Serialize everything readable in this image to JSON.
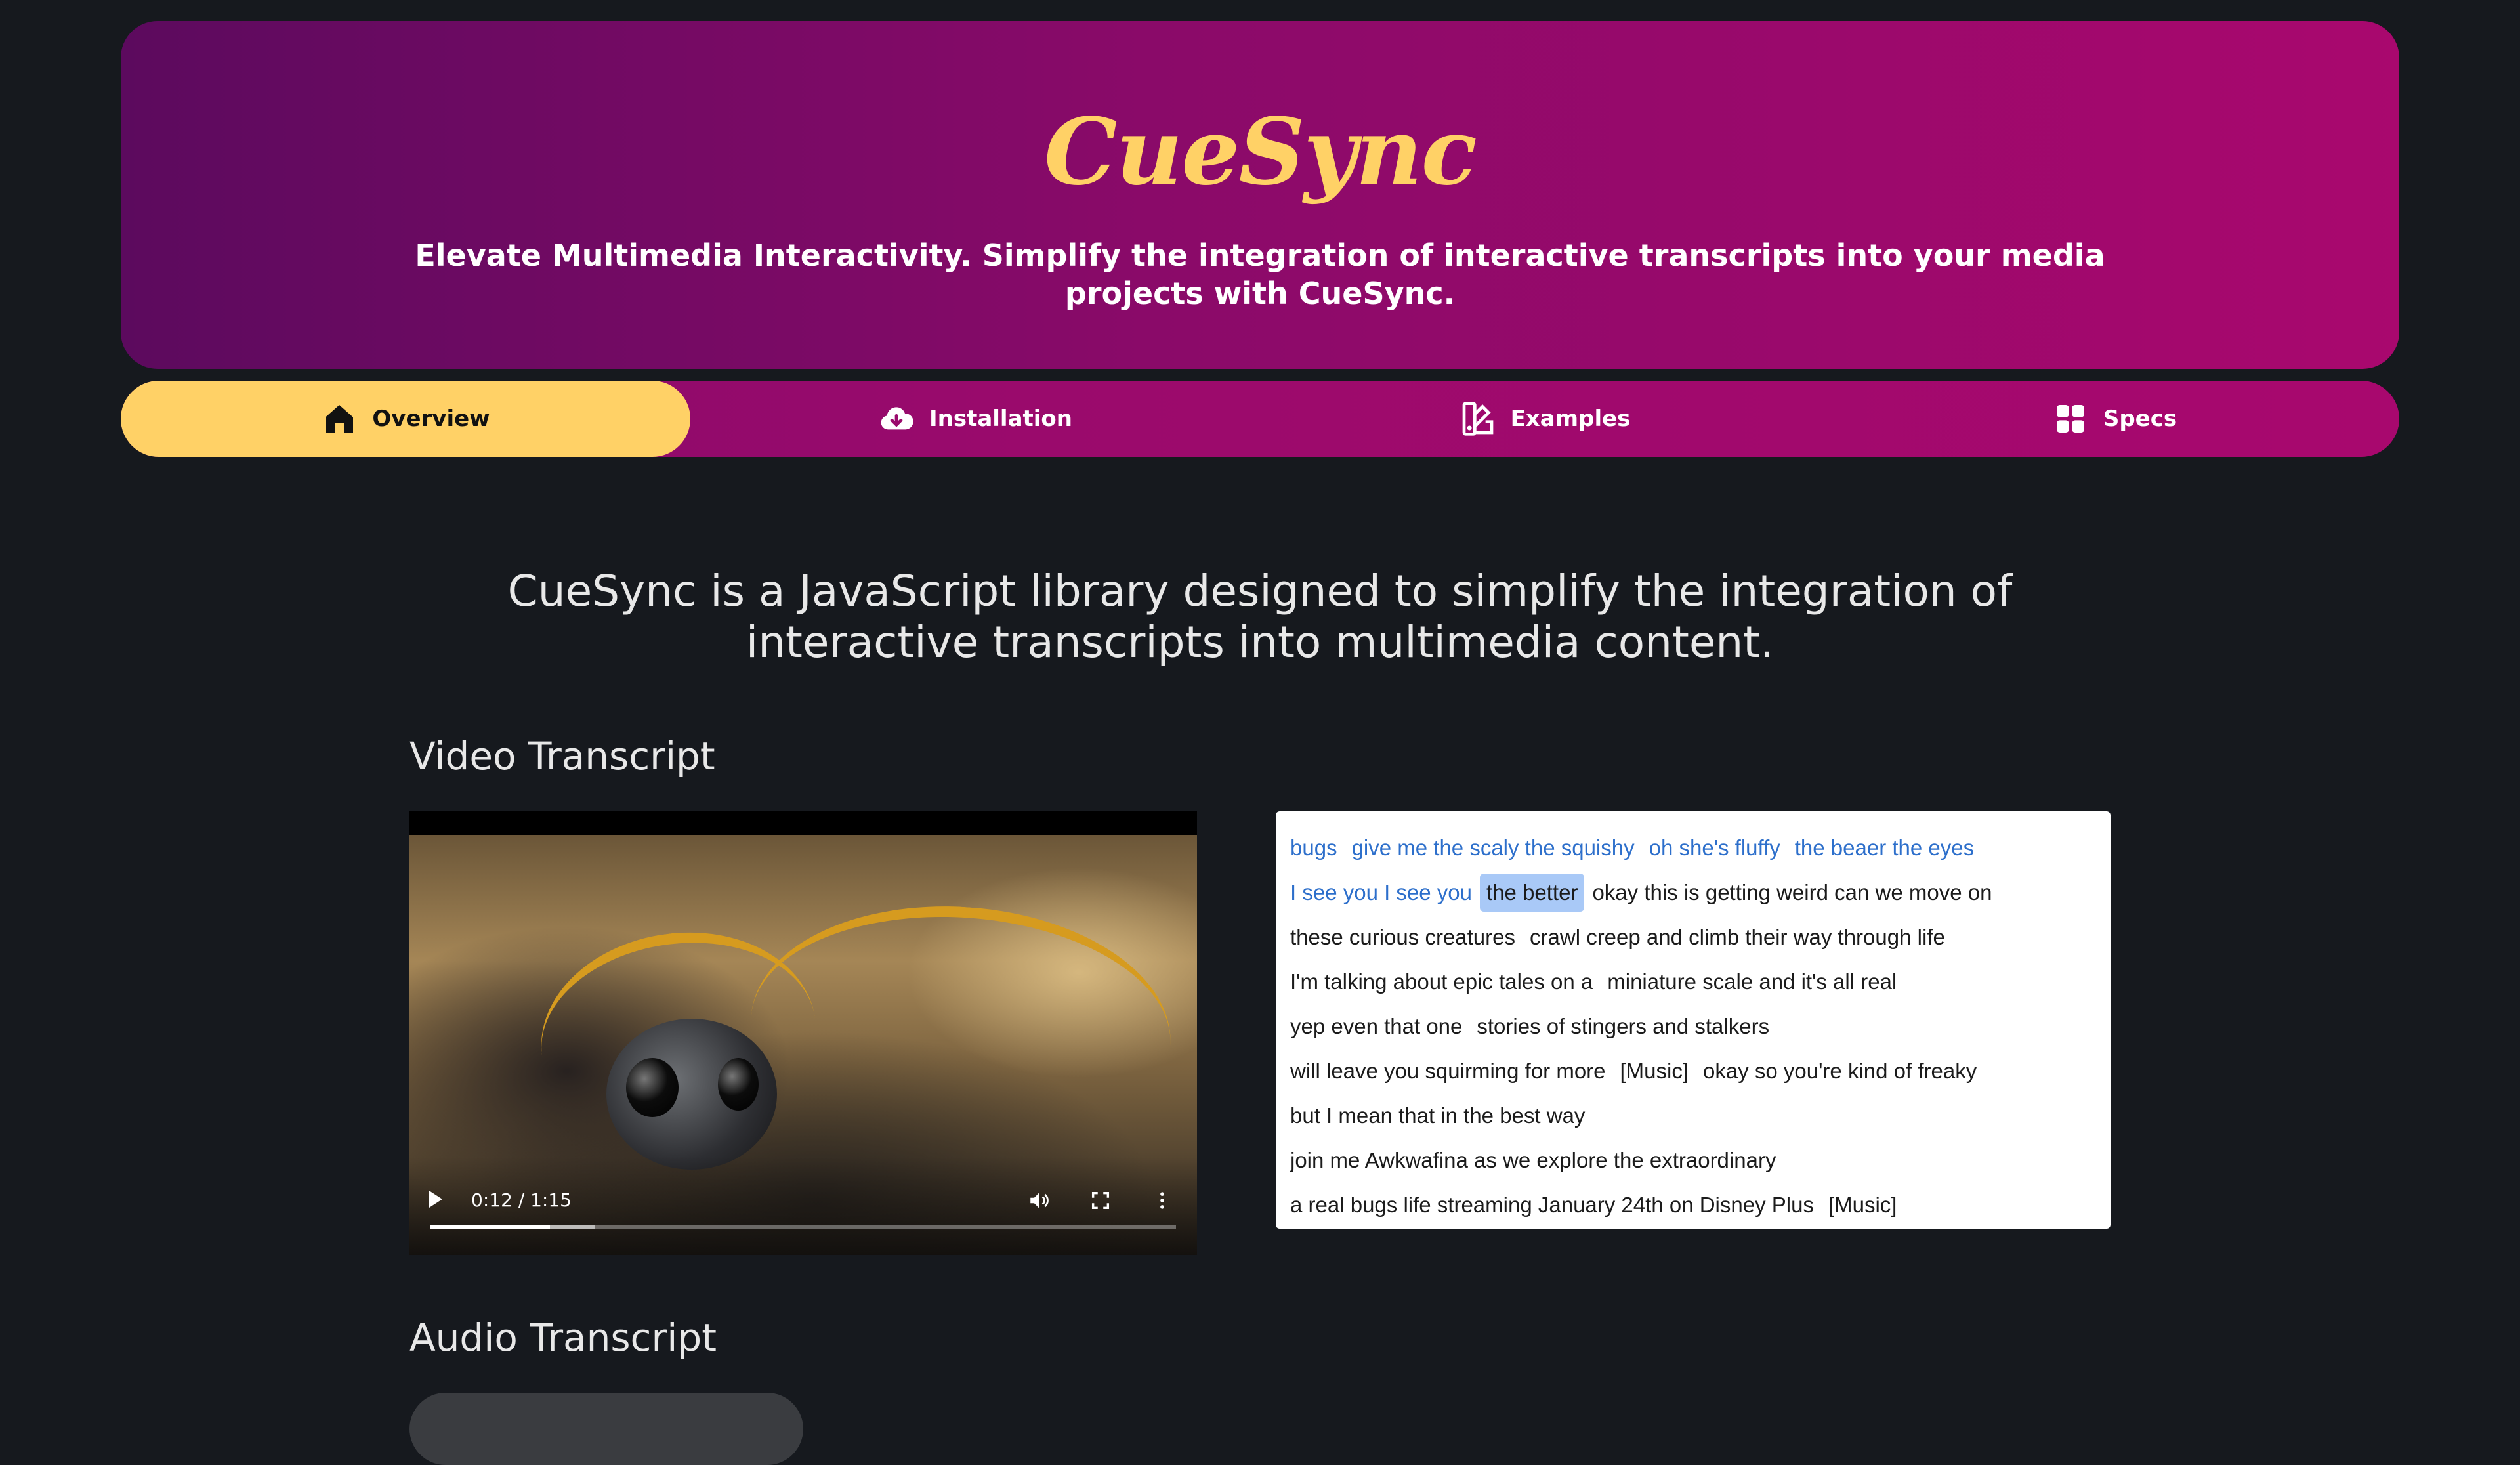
{
  "header": {
    "logo": "CueSync",
    "tagline": "Elevate Multimedia Interactivity. Simplify the integration of interactive transcripts into your media projects with CueSync."
  },
  "nav": {
    "items": [
      {
        "label": "Overview",
        "icon": "home-icon",
        "active": true
      },
      {
        "label": "Installation",
        "icon": "cloud-download-icon",
        "active": false
      },
      {
        "label": "Examples",
        "icon": "swatch-icon",
        "active": false
      },
      {
        "label": "Specs",
        "icon": "grid-icon",
        "active": false
      }
    ]
  },
  "intro": "CueSync is a JavaScript library designed to simplify the integration of interactive transcripts into multimedia content.",
  "sections": {
    "video_title": "Video Transcript",
    "audio_title": "Audio Transcript"
  },
  "video": {
    "time": "0:12 / 1:15",
    "progress_fraction": 0.16,
    "buffered_fraction": 0.22
  },
  "transcript": {
    "lines": [
      [
        {
          "text": "bugs",
          "state": "past"
        },
        {
          "text": "give me the scaly the squishy",
          "state": "past"
        },
        {
          "text": "oh she's fluffy",
          "state": "past"
        },
        {
          "text": "the beaer the eyes",
          "state": "past"
        }
      ],
      [
        {
          "text": "I see you I see you",
          "state": "past"
        },
        {
          "text": "the better",
          "state": "active"
        },
        {
          "text": "okay this is getting weird can we move on",
          "state": "future"
        }
      ],
      [
        {
          "text": "these curious creatures",
          "state": "future"
        },
        {
          "text": "crawl creep and climb their way through life",
          "state": "future"
        }
      ],
      [
        {
          "text": "I'm talking about epic tales on a",
          "state": "future"
        },
        {
          "text": "miniature scale and it's all real",
          "state": "future"
        }
      ],
      [
        {
          "text": "yep even that one",
          "state": "future"
        },
        {
          "text": "stories of stingers and stalkers",
          "state": "future"
        }
      ],
      [
        {
          "text": "will leave you squirming for more",
          "state": "future"
        },
        {
          "text": "[Music]",
          "state": "future"
        },
        {
          "text": "okay so you're kind of freaky",
          "state": "future"
        }
      ],
      [
        {
          "text": "but I mean that in the best way",
          "state": "future"
        }
      ],
      [
        {
          "text": "join me Awkwafina as we explore the extraordinary",
          "state": "future"
        }
      ],
      [
        {
          "text": "a real bugs life streaming January 24th on Disney Plus",
          "state": "future"
        },
        {
          "text": "[Music]",
          "state": "future"
        }
      ]
    ]
  },
  "colors": {
    "accent": "#ffd166",
    "header_start": "#5c0a5e",
    "header_end": "#a9086e",
    "background": "#16191e",
    "past_cue": "#2d6fcb",
    "active_cue": "#a9c9f7"
  }
}
